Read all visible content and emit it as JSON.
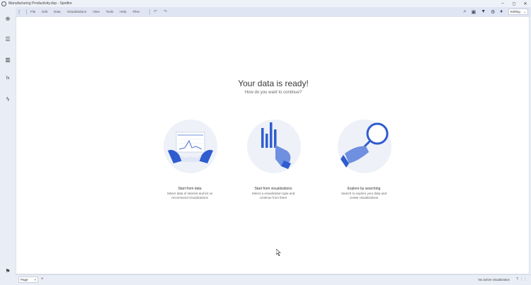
{
  "window": {
    "title": "Manufacturing Productivity.dxp - Spotfire",
    "minimize": "–",
    "maximize": "◻",
    "close": "✕"
  },
  "toolbar": {
    "menu": [
      "File",
      "Edit",
      "Data",
      "Visualizations",
      "View",
      "Tools",
      "Help",
      "Files"
    ],
    "editing_label": "Editing",
    "editing_arrow": "⌄",
    "kebab": "⋮",
    "undo_icon": "↶",
    "redo_icon": "↷",
    "search_icon": "⌕",
    "bookmark_icon": "▣",
    "filter_icon": "▼",
    "settings_icon": "⚙",
    "notify_icon": "♦"
  },
  "sidebar": {
    "items": [
      {
        "name": "add-data-icon",
        "glyph": "⊕"
      },
      {
        "name": "data-panel-icon",
        "glyph": "☰"
      },
      {
        "name": "visualization-types-icon",
        "glyph": "▥"
      },
      {
        "name": "analytics-icon",
        "glyph": "fx"
      },
      {
        "name": "recommendations-icon",
        "glyph": "ϟ"
      }
    ],
    "bottom_icon": "⚑"
  },
  "main": {
    "heading": "Your data is ready!",
    "subheading": "How do you want to continue?",
    "cards": [
      {
        "title": "Start from data",
        "desc1": "Select data of interest and let us",
        "desc2": "recommend visualizations"
      },
      {
        "title": "Start from visualizations",
        "desc1": "Select a visualization type and",
        "desc2": "continue from there"
      },
      {
        "title": "Explore by searching",
        "desc1": "Search to explore your data and",
        "desc2": "create visualizations"
      }
    ]
  },
  "statusbar": {
    "page_tab": "Page",
    "page_tab_close": "×",
    "add_page": "+",
    "status_text": "No active visualization",
    "help_icon": "?",
    "grid_icon": "⋮⋮"
  },
  "colors": {
    "accent": "#2f5ccf",
    "accent_light": "#6f8fe0",
    "circle_bg": "#eef1f8"
  }
}
